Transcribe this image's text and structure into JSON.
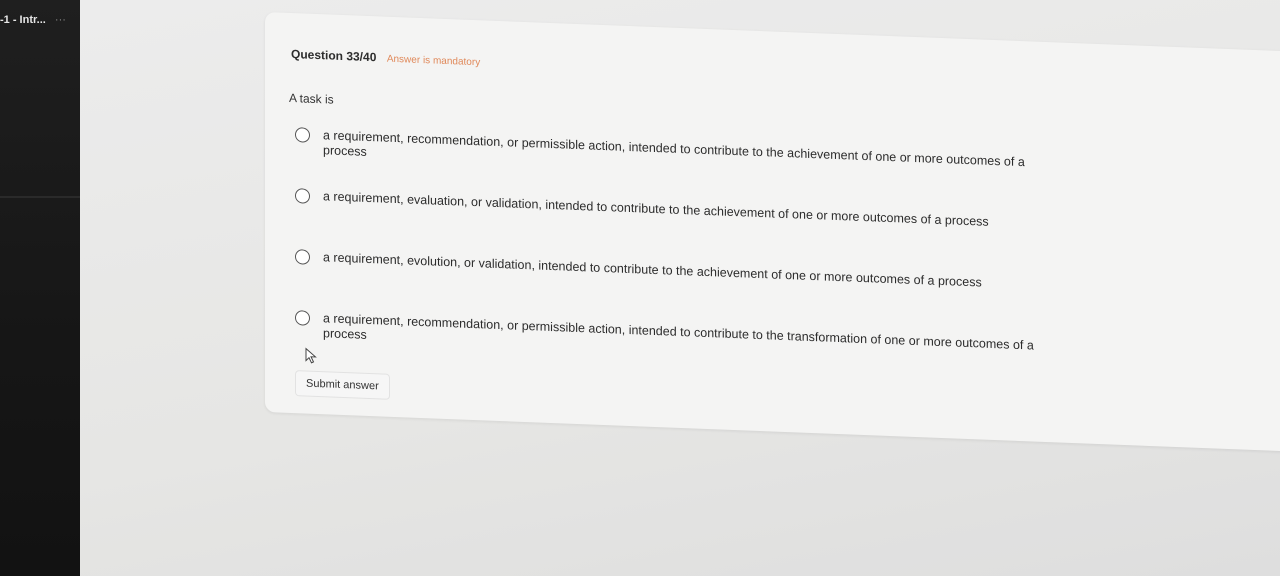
{
  "tab": {
    "title": "-1 - Intr...",
    "more": "···"
  },
  "question": {
    "number": "Question 33/40",
    "mandatory": "Answer is mandatory",
    "text": "A task is",
    "options": [
      "a requirement, recommendation, or permissible action, intended to contribute to the achievement of one or more outcomes of a process",
      "a requirement, evaluation, or validation, intended to contribute to the achievement of one or more outcomes of a process",
      "a requirement, evolution, or validation, intended to contribute to the achievement of one or more outcomes of a process",
      "a requirement, recommendation, or permissible action, intended to contribute to the transformation of one or more outcomes of a process"
    ]
  },
  "submit_label": "Submit answer",
  "colors": {
    "mandatory": "#e0895a",
    "sidebar": "#1a1a1a"
  },
  "icons": {
    "radio": "radio-unchecked-icon",
    "cursor": "mouse-cursor-icon"
  }
}
